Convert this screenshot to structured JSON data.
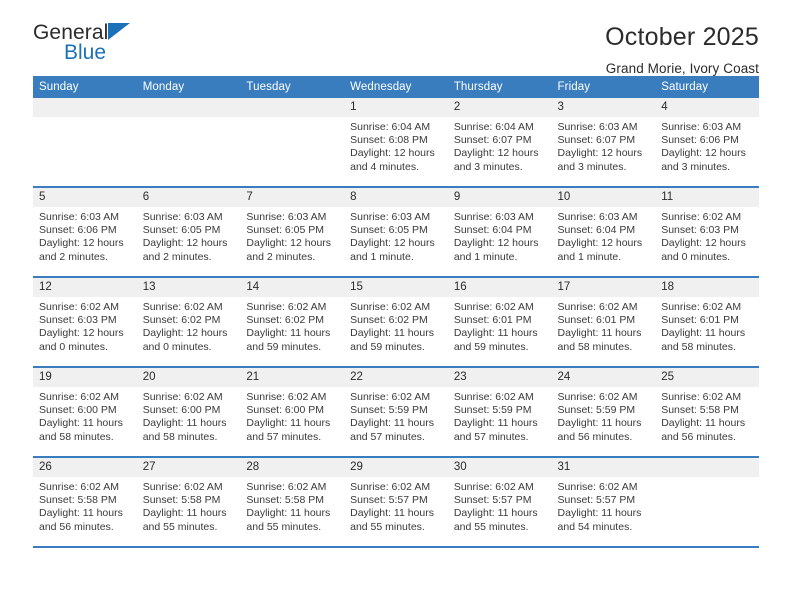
{
  "brand": {
    "name_top": "General",
    "name_bottom": "Blue",
    "accent_color": "#1b72b8"
  },
  "header": {
    "title": "October 2025",
    "subtitle": "Grand Morie, Ivory Coast"
  },
  "colors": {
    "header_row_bg": "#3a7dbf",
    "daynum_bg": "#f0f0f0",
    "text": "#2b2b2b"
  },
  "weekdays": [
    "Sunday",
    "Monday",
    "Tuesday",
    "Wednesday",
    "Thursday",
    "Friday",
    "Saturday"
  ],
  "labels": {
    "sunrise_prefix": "Sunrise:",
    "sunset_prefix": "Sunset:",
    "daylight_prefix": "Daylight:"
  },
  "weeks": [
    [
      {
        "day": "",
        "empty": true
      },
      {
        "day": "",
        "empty": true
      },
      {
        "day": "",
        "empty": true
      },
      {
        "day": "1",
        "sunrise": "Sunrise: 6:04 AM",
        "sunset": "Sunset: 6:08 PM",
        "daylight_1": "Daylight: 12 hours",
        "daylight_2": "and 4 minutes."
      },
      {
        "day": "2",
        "sunrise": "Sunrise: 6:04 AM",
        "sunset": "Sunset: 6:07 PM",
        "daylight_1": "Daylight: 12 hours",
        "daylight_2": "and 3 minutes."
      },
      {
        "day": "3",
        "sunrise": "Sunrise: 6:03 AM",
        "sunset": "Sunset: 6:07 PM",
        "daylight_1": "Daylight: 12 hours",
        "daylight_2": "and 3 minutes."
      },
      {
        "day": "4",
        "sunrise": "Sunrise: 6:03 AM",
        "sunset": "Sunset: 6:06 PM",
        "daylight_1": "Daylight: 12 hours",
        "daylight_2": "and 3 minutes."
      }
    ],
    [
      {
        "day": "5",
        "sunrise": "Sunrise: 6:03 AM",
        "sunset": "Sunset: 6:06 PM",
        "daylight_1": "Daylight: 12 hours",
        "daylight_2": "and 2 minutes."
      },
      {
        "day": "6",
        "sunrise": "Sunrise: 6:03 AM",
        "sunset": "Sunset: 6:05 PM",
        "daylight_1": "Daylight: 12 hours",
        "daylight_2": "and 2 minutes."
      },
      {
        "day": "7",
        "sunrise": "Sunrise: 6:03 AM",
        "sunset": "Sunset: 6:05 PM",
        "daylight_1": "Daylight: 12 hours",
        "daylight_2": "and 2 minutes."
      },
      {
        "day": "8",
        "sunrise": "Sunrise: 6:03 AM",
        "sunset": "Sunset: 6:05 PM",
        "daylight_1": "Daylight: 12 hours",
        "daylight_2": "and 1 minute."
      },
      {
        "day": "9",
        "sunrise": "Sunrise: 6:03 AM",
        "sunset": "Sunset: 6:04 PM",
        "daylight_1": "Daylight: 12 hours",
        "daylight_2": "and 1 minute."
      },
      {
        "day": "10",
        "sunrise": "Sunrise: 6:03 AM",
        "sunset": "Sunset: 6:04 PM",
        "daylight_1": "Daylight: 12 hours",
        "daylight_2": "and 1 minute."
      },
      {
        "day": "11",
        "sunrise": "Sunrise: 6:02 AM",
        "sunset": "Sunset: 6:03 PM",
        "daylight_1": "Daylight: 12 hours",
        "daylight_2": "and 0 minutes."
      }
    ],
    [
      {
        "day": "12",
        "sunrise": "Sunrise: 6:02 AM",
        "sunset": "Sunset: 6:03 PM",
        "daylight_1": "Daylight: 12 hours",
        "daylight_2": "and 0 minutes."
      },
      {
        "day": "13",
        "sunrise": "Sunrise: 6:02 AM",
        "sunset": "Sunset: 6:02 PM",
        "daylight_1": "Daylight: 12 hours",
        "daylight_2": "and 0 minutes."
      },
      {
        "day": "14",
        "sunrise": "Sunrise: 6:02 AM",
        "sunset": "Sunset: 6:02 PM",
        "daylight_1": "Daylight: 11 hours",
        "daylight_2": "and 59 minutes."
      },
      {
        "day": "15",
        "sunrise": "Sunrise: 6:02 AM",
        "sunset": "Sunset: 6:02 PM",
        "daylight_1": "Daylight: 11 hours",
        "daylight_2": "and 59 minutes."
      },
      {
        "day": "16",
        "sunrise": "Sunrise: 6:02 AM",
        "sunset": "Sunset: 6:01 PM",
        "daylight_1": "Daylight: 11 hours",
        "daylight_2": "and 59 minutes."
      },
      {
        "day": "17",
        "sunrise": "Sunrise: 6:02 AM",
        "sunset": "Sunset: 6:01 PM",
        "daylight_1": "Daylight: 11 hours",
        "daylight_2": "and 58 minutes."
      },
      {
        "day": "18",
        "sunrise": "Sunrise: 6:02 AM",
        "sunset": "Sunset: 6:01 PM",
        "daylight_1": "Daylight: 11 hours",
        "daylight_2": "and 58 minutes."
      }
    ],
    [
      {
        "day": "19",
        "sunrise": "Sunrise: 6:02 AM",
        "sunset": "Sunset: 6:00 PM",
        "daylight_1": "Daylight: 11 hours",
        "daylight_2": "and 58 minutes."
      },
      {
        "day": "20",
        "sunrise": "Sunrise: 6:02 AM",
        "sunset": "Sunset: 6:00 PM",
        "daylight_1": "Daylight: 11 hours",
        "daylight_2": "and 58 minutes."
      },
      {
        "day": "21",
        "sunrise": "Sunrise: 6:02 AM",
        "sunset": "Sunset: 6:00 PM",
        "daylight_1": "Daylight: 11 hours",
        "daylight_2": "and 57 minutes."
      },
      {
        "day": "22",
        "sunrise": "Sunrise: 6:02 AM",
        "sunset": "Sunset: 5:59 PM",
        "daylight_1": "Daylight: 11 hours",
        "daylight_2": "and 57 minutes."
      },
      {
        "day": "23",
        "sunrise": "Sunrise: 6:02 AM",
        "sunset": "Sunset: 5:59 PM",
        "daylight_1": "Daylight: 11 hours",
        "daylight_2": "and 57 minutes."
      },
      {
        "day": "24",
        "sunrise": "Sunrise: 6:02 AM",
        "sunset": "Sunset: 5:59 PM",
        "daylight_1": "Daylight: 11 hours",
        "daylight_2": "and 56 minutes."
      },
      {
        "day": "25",
        "sunrise": "Sunrise: 6:02 AM",
        "sunset": "Sunset: 5:58 PM",
        "daylight_1": "Daylight: 11 hours",
        "daylight_2": "and 56 minutes."
      }
    ],
    [
      {
        "day": "26",
        "sunrise": "Sunrise: 6:02 AM",
        "sunset": "Sunset: 5:58 PM",
        "daylight_1": "Daylight: 11 hours",
        "daylight_2": "and 56 minutes."
      },
      {
        "day": "27",
        "sunrise": "Sunrise: 6:02 AM",
        "sunset": "Sunset: 5:58 PM",
        "daylight_1": "Daylight: 11 hours",
        "daylight_2": "and 55 minutes."
      },
      {
        "day": "28",
        "sunrise": "Sunrise: 6:02 AM",
        "sunset": "Sunset: 5:58 PM",
        "daylight_1": "Daylight: 11 hours",
        "daylight_2": "and 55 minutes."
      },
      {
        "day": "29",
        "sunrise": "Sunrise: 6:02 AM",
        "sunset": "Sunset: 5:57 PM",
        "daylight_1": "Daylight: 11 hours",
        "daylight_2": "and 55 minutes."
      },
      {
        "day": "30",
        "sunrise": "Sunrise: 6:02 AM",
        "sunset": "Sunset: 5:57 PM",
        "daylight_1": "Daylight: 11 hours",
        "daylight_2": "and 55 minutes."
      },
      {
        "day": "31",
        "sunrise": "Sunrise: 6:02 AM",
        "sunset": "Sunset: 5:57 PM",
        "daylight_1": "Daylight: 11 hours",
        "daylight_2": "and 54 minutes."
      },
      {
        "day": "",
        "empty": true
      }
    ]
  ]
}
